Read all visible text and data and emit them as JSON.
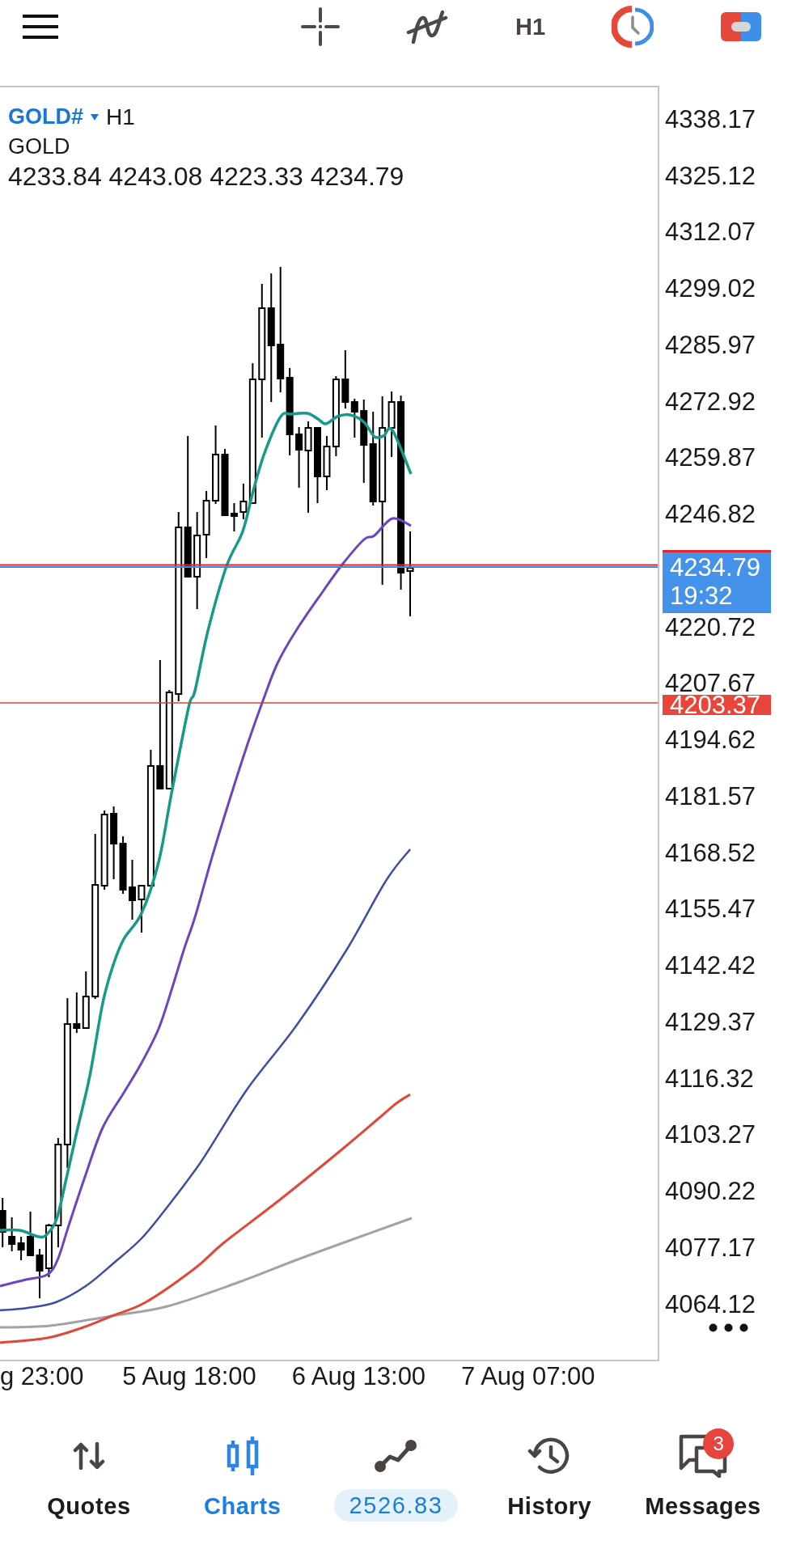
{
  "toolbar": {
    "timeframe": "H1"
  },
  "chart": {
    "symbol": "GOLD#",
    "timeframe": "H1",
    "name": "GOLD",
    "ohlc": "4233.84 4243.08 4223.33 4234.79",
    "price_axis": [
      "4338.17",
      "4325.12",
      "4312.07",
      "4299.02",
      "4285.97",
      "4272.92",
      "4259.87",
      "4246.82",
      "4220.72",
      "4207.67",
      "4194.62",
      "4181.57",
      "4168.52",
      "4155.47",
      "4142.42",
      "4129.37",
      "4116.32",
      "4103.27",
      "4090.22",
      "4077.17",
      "4064.12"
    ],
    "time_axis": [
      "g 23:00",
      "5 Aug 18:00",
      "6 Aug 13:00",
      "7 Aug 07:00"
    ],
    "current_price": {
      "price": "4234.79",
      "countdown": "19:32"
    },
    "level_price": "4203.37"
  },
  "nav": [
    {
      "kind": "quotes",
      "label": "Quotes",
      "selected": false
    },
    {
      "kind": "charts",
      "label": "Charts",
      "selected": true
    },
    {
      "kind": "trade",
      "label": "2526.83",
      "selected": false
    },
    {
      "kind": "history",
      "label": "History",
      "selected": false
    },
    {
      "kind": "messages",
      "label": "Messages",
      "selected": false,
      "badge": "3"
    }
  ]
}
